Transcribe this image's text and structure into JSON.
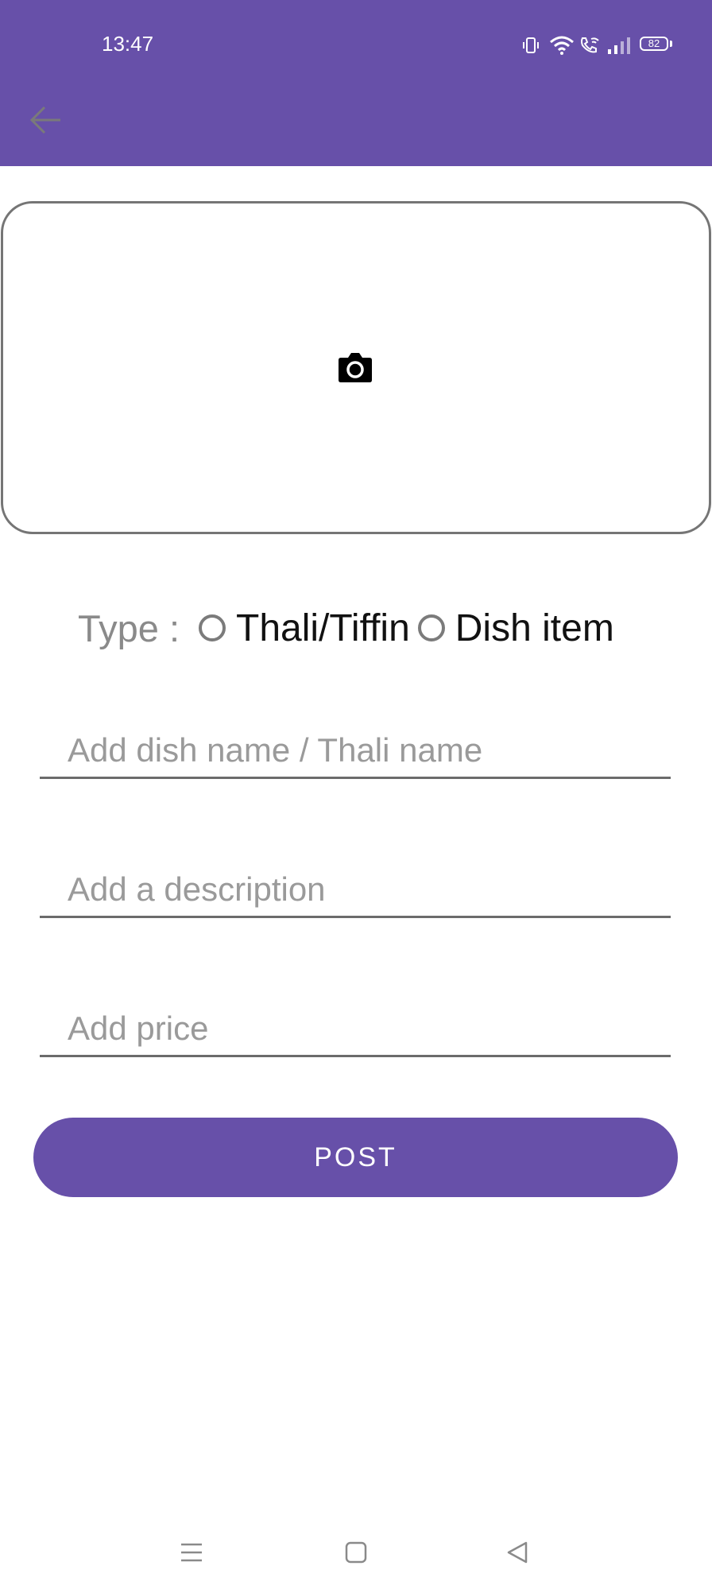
{
  "status_bar": {
    "time": "13:47",
    "battery": "82",
    "icons": [
      "vibrate-icon",
      "wifi-icon",
      "wifi-call-icon",
      "signal-icon",
      "battery-icon"
    ]
  },
  "toolbar": {
    "back_icon": "arrow-back-icon"
  },
  "photo": {
    "icon": "camera-icon"
  },
  "type_selector": {
    "label": "Type :",
    "options": [
      "Thali/Tiffin",
      "Dish item"
    ],
    "selected": null
  },
  "form": {
    "dish_name": {
      "placeholder": "Add dish name / Thali name",
      "value": ""
    },
    "description": {
      "placeholder": "Add a description",
      "value": ""
    },
    "price": {
      "placeholder": "Add price",
      "value": ""
    }
  },
  "post_button": {
    "label": "POST"
  },
  "system_nav": [
    "menu-icon",
    "home-icon",
    "back-triangle-icon"
  ],
  "colors": {
    "primary": "#6750A9",
    "divider": "#6b6b6b",
    "placeholder": "#9a9a9a"
  }
}
